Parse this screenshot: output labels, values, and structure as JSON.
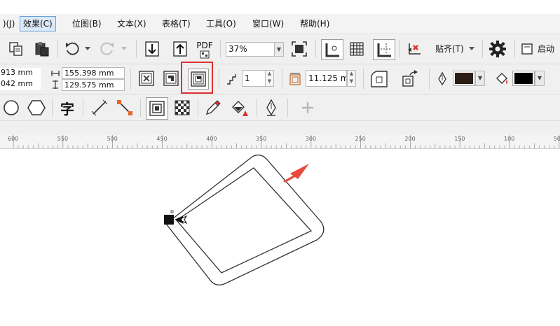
{
  "menu": {
    "items": [
      {
        "label": " )(J)",
        "active": false
      },
      {
        "label": "效果(C)",
        "active": true
      },
      {
        "label": "位图(B)",
        "active": false
      },
      {
        "label": "文本(X)",
        "active": false
      },
      {
        "label": "表格(T)",
        "active": false
      },
      {
        "label": "工具(O)",
        "active": false
      },
      {
        "label": "窗口(W)",
        "active": false
      },
      {
        "label": "帮助(H)",
        "active": false
      }
    ]
  },
  "standard_toolbar": {
    "pdf_label": "PDF",
    "zoom_value": "37%",
    "snap_label": "贴齐(T)",
    "launch_label": "启动"
  },
  "property_bar": {
    "x_value": "913 mm",
    "y_value": "042 mm",
    "width_value": "155.398 mm",
    "height_value": "129.575 mm",
    "corner_radius_value": "1",
    "contour_offset_value": "11.125 mr"
  },
  "colors": {
    "outline_swatch": "#2a1d16",
    "fill_swatch": "#000000",
    "highlight_border": "#e03030",
    "arrow": "#e84a3c"
  },
  "ruler": {
    "labels": [
      "600",
      "550",
      "500",
      "450",
      "400",
      "350",
      "300",
      "250",
      "200",
      "150",
      "100",
      "50"
    ]
  }
}
